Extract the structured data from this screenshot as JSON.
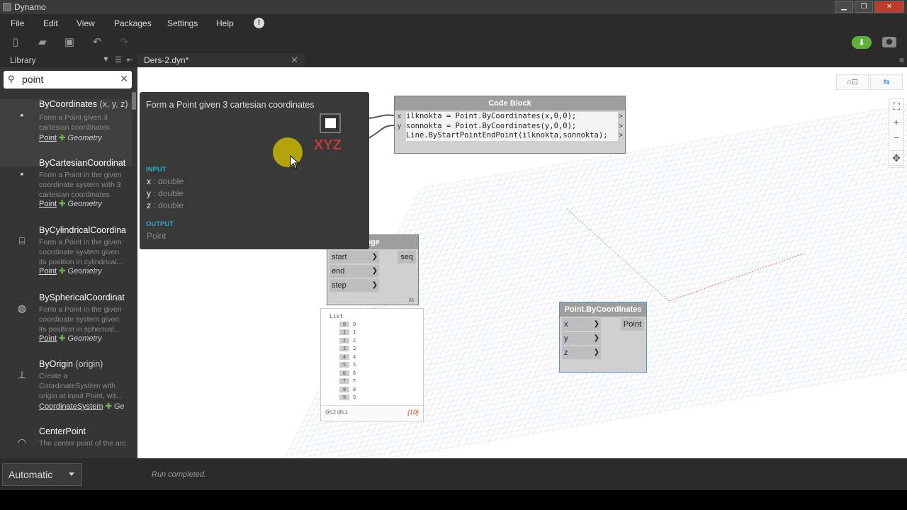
{
  "window": {
    "title": "Dynamo"
  },
  "menu": {
    "items": [
      "File",
      "Edit",
      "View",
      "Packages",
      "Settings",
      "Help"
    ]
  },
  "library": {
    "header": "Library",
    "search": {
      "value": "point",
      "placeholder": ""
    },
    "items": [
      {
        "name": "ByCoordinates",
        "args": "(x, y, z)",
        "desc": "Form a Point given 3 cartesian coordinates",
        "category": "Point",
        "sub": "Geometry"
      },
      {
        "name": "ByCartesianCoordinat",
        "args": "",
        "desc": "Form a Point in the given coordinate system with 3 cartesian coordinates",
        "category": "Point",
        "sub": "Geometry"
      },
      {
        "name": "ByCylindricalCoordina",
        "args": "",
        "desc": "Form a Point in the given coordinate system given its position in cylindrical...",
        "category": "Point",
        "sub": "Geometry"
      },
      {
        "name": "BySphericalCoordinat",
        "args": "",
        "desc": "Form a Point in the given coordinate system given its position in spherical...",
        "category": "Point",
        "sub": "Geometry"
      },
      {
        "name": "ByOrigin",
        "args": "(origin)",
        "desc": "Create a CoordinateSystem with origin at input Point, wit...",
        "category": "CoordinateSystem",
        "sub": "Ge"
      },
      {
        "name": "CenterPoint",
        "args": "",
        "desc": "The center point of the arc",
        "category": "",
        "sub": ""
      }
    ]
  },
  "tab": {
    "label": "Ders-2.dyn*"
  },
  "tooltip": {
    "description": "Form a Point given 3 cartesian coordinates",
    "icon_text": "XYZ",
    "input_header": "INPUT",
    "inputs": [
      {
        "name": "x",
        "type": ": double"
      },
      {
        "name": "y",
        "type": ": double"
      },
      {
        "name": "z",
        "type": ": double"
      }
    ],
    "output_header": "OUTPUT",
    "output": "Point"
  },
  "code_block": {
    "title": "Code Block",
    "ports": [
      "x",
      "y"
    ],
    "lines": [
      "ilknokta = Point.ByCoordinates(x,0,0);",
      "sonnokta = Point.ByCoordinates(y,0,0);",
      "Line.ByStartPointEndPoint(ilknokta,sonnokta);"
    ]
  },
  "range_node": {
    "title_visible": "nge",
    "inputs": [
      "start",
      "end",
      "step"
    ],
    "output": "seq",
    "lacing": "l\\l\\"
  },
  "watch": {
    "title": "List",
    "items": [
      {
        "i": "0",
        "v": "0"
      },
      {
        "i": "1",
        "v": "1"
      },
      {
        "i": "2",
        "v": "2"
      },
      {
        "i": "3",
        "v": "3"
      },
      {
        "i": "4",
        "v": "4"
      },
      {
        "i": "5",
        "v": "5"
      },
      {
        "i": "6",
        "v": "6"
      },
      {
        "i": "7",
        "v": "7"
      },
      {
        "i": "8",
        "v": "8"
      },
      {
        "i": "9",
        "v": "9"
      }
    ],
    "levels": "@L2 @L1",
    "count": "{10}"
  },
  "point_node": {
    "title": "Point.ByCoordinates",
    "inputs": [
      "x",
      "y",
      "z"
    ],
    "output": "Point"
  },
  "status": {
    "run_mode": "Automatic",
    "message": "Run completed."
  },
  "colors": {
    "accent_green": "#5cb338",
    "tooltip_header": "#2fa8c8",
    "xyz_red": "#c0393b"
  }
}
